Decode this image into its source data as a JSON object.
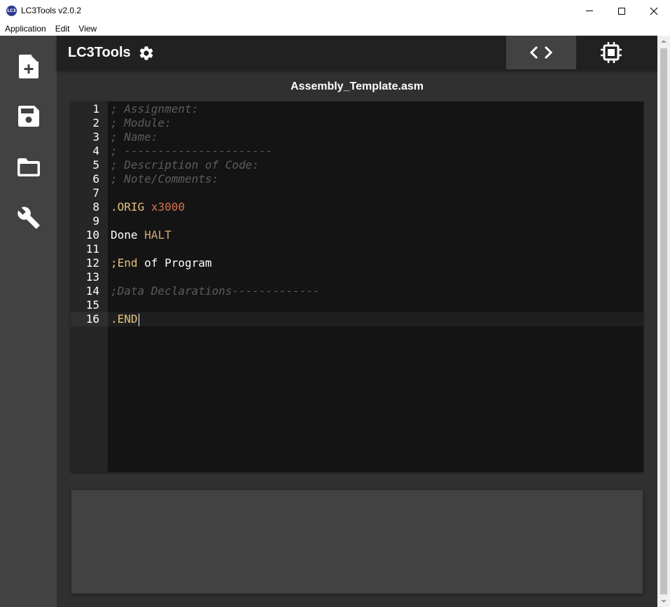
{
  "window": {
    "icon_text": "LC3",
    "title": "LC3Tools v2.0.2"
  },
  "menu": {
    "items": [
      "Application",
      "Edit",
      "View"
    ]
  },
  "sidebar": {
    "items": [
      {
        "name": "new-file",
        "icon": "file-plus-icon"
      },
      {
        "name": "save-file",
        "icon": "floppy-disk-icon"
      },
      {
        "name": "open-folder",
        "icon": "folder-icon"
      },
      {
        "name": "build",
        "icon": "wrench-icon"
      }
    ]
  },
  "toolbar": {
    "brand": "LC3Tools",
    "settings_icon": "gear-icon",
    "editor_icon": "code-brackets-icon",
    "simulator_icon": "chip-icon"
  },
  "editor": {
    "filename": "Assembly_Template.asm",
    "active_line": 16,
    "lines": [
      {
        "n": "1",
        "tokens": [
          {
            "t": "; Assignment:",
            "k": "comment"
          }
        ]
      },
      {
        "n": "2",
        "tokens": [
          {
            "t": "; Module:",
            "k": "comment"
          }
        ]
      },
      {
        "n": "3",
        "tokens": [
          {
            "t": "; Name:",
            "k": "comment"
          }
        ]
      },
      {
        "n": "4",
        "tokens": [
          {
            "t": "; ----------------------",
            "k": "comment"
          }
        ]
      },
      {
        "n": "5",
        "tokens": [
          {
            "t": "; Description of Code:",
            "k": "comment"
          }
        ]
      },
      {
        "n": "6",
        "tokens": [
          {
            "t": "; Note/Comments:",
            "k": "comment"
          }
        ]
      },
      {
        "n": "7",
        "tokens": []
      },
      {
        "n": "8",
        "tokens": [
          {
            "t": ".ORIG",
            "k": "directive"
          },
          {
            "t": " ",
            "k": "text"
          },
          {
            "t": "x3000",
            "k": "number"
          }
        ]
      },
      {
        "n": "9",
        "tokens": []
      },
      {
        "n": "10",
        "tokens": [
          {
            "t": "Done",
            "k": "label"
          },
          {
            "t": " ",
            "k": "text"
          },
          {
            "t": "HALT",
            "k": "opcode"
          }
        ]
      },
      {
        "n": "11",
        "tokens": []
      },
      {
        "n": "12",
        "tokens": [
          {
            "t": ";End",
            "k": "directive"
          },
          {
            "t": " of Program",
            "k": "text"
          }
        ]
      },
      {
        "n": "13",
        "tokens": []
      },
      {
        "n": "14",
        "tokens": [
          {
            "t": ";Data Declarations-------------",
            "k": "comment"
          }
        ]
      },
      {
        "n": "15",
        "tokens": []
      },
      {
        "n": "16",
        "tokens": [
          {
            "t": ".END",
            "k": "directive"
          }
        ]
      }
    ]
  },
  "colors": {
    "sidebar_bg": "#424242",
    "toolbar_bg": "#212121",
    "main_bg": "#303030",
    "editor_bg": "#141414",
    "comment": "#5c5c5c",
    "directive": "#e6c07b",
    "number": "#d8734a",
    "opcode": "#d1a771"
  }
}
